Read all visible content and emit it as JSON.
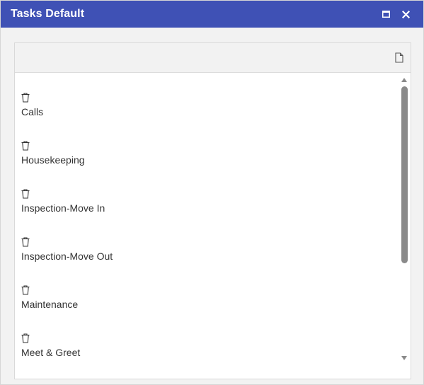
{
  "window": {
    "title": "Tasks Default",
    "title_bar_color": "#3f51b5",
    "maximize_icon": "maximize-icon",
    "close_icon": "close-icon"
  },
  "toolbar": {
    "new_icon": "new-document-icon"
  },
  "items": [
    {
      "label": "Calls",
      "icon": "trash-icon"
    },
    {
      "label": "Housekeeping",
      "icon": "trash-icon"
    },
    {
      "label": "Inspection-Move In",
      "icon": "trash-icon"
    },
    {
      "label": "Inspection-Move Out",
      "icon": "trash-icon"
    },
    {
      "label": "Maintenance",
      "icon": "trash-icon"
    },
    {
      "label": "Meet & Greet",
      "icon": "trash-icon"
    }
  ],
  "scroll_position": 0
}
